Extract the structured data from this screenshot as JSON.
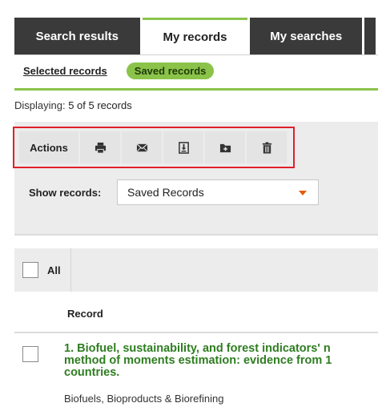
{
  "tabs": [
    {
      "label": "Search results"
    },
    {
      "label": "My records",
      "active": true
    },
    {
      "label": "My searches"
    },
    {
      "label": ""
    }
  ],
  "subtabs": {
    "selected_records": "Selected records",
    "saved_records": "Saved records"
  },
  "displaying": {
    "label": "Displaying:",
    "value": "5 of 5 records"
  },
  "actions": {
    "label": "Actions",
    "buttons": [
      {
        "name": "print-icon"
      },
      {
        "name": "email-icon"
      },
      {
        "name": "export-icon"
      },
      {
        "name": "add-to-folder-icon"
      },
      {
        "name": "delete-icon"
      }
    ]
  },
  "show_records": {
    "label": "Show records:",
    "selected": "Saved Records"
  },
  "list": {
    "all_label": "All",
    "column_header": "Record",
    "records": [
      {
        "title_line1": "1. Biofuel, sustainability, and forest indicators' n",
        "title_line2": "method of moments estimation: evidence from 1",
        "title_line3": "countries.",
        "source": "Biofuels, Bioproducts & Biorefining"
      }
    ]
  },
  "colors": {
    "accent": "#8bc34a",
    "dark_tab": "#3a3a3a",
    "title_green": "#2e7d20",
    "highlight": "#e0202a"
  }
}
